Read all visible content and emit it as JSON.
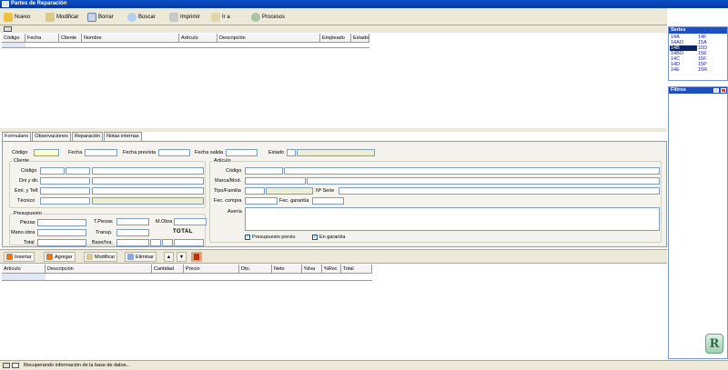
{
  "window": {
    "title": "Partes de Reparación"
  },
  "toolbar": {
    "nuevo": "Nuevo",
    "modificar": "Modificar",
    "borrar": "Borrar",
    "buscar": "Buscar",
    "imprimir": "Imprimir",
    "ira": "Ir a",
    "procesos": "Procesos"
  },
  "top_grid": {
    "columns": [
      "Código",
      "Fecha",
      "Cliente",
      "Nombre",
      "Artículo",
      "Descripción",
      "Empleado",
      "Estado"
    ]
  },
  "series_panel": {
    "title": "Series",
    "items": [
      "14A",
      "14F",
      "14AO",
      "15A",
      "14B",
      "15D",
      "14BO",
      "15E",
      "14C",
      "15F",
      "14D",
      "15P",
      "14E",
      "15R"
    ],
    "selected": "14B"
  },
  "filters_panel": {
    "title": "Filtros"
  },
  "tabs": [
    "Formulario",
    "Observaciones",
    "Reparación",
    "Notas internas"
  ],
  "form": {
    "codigo": "Código",
    "fecha": "Fecha",
    "fecha_prevista": "Fecha prevista",
    "fecha_salida": "Fecha salida",
    "estado": "Estado",
    "cliente_group": "Cliente",
    "cli_codigo": "Código",
    "cli_dni": "Dni y dir.",
    "cli_email": "Eml. y Telf.",
    "cli_tecnico": "Técnico",
    "articulo_group": "Artículo",
    "art_codigo": "Código",
    "art_marca": "Marca/Mod.",
    "art_tipo": "Tipo/Familia",
    "art_nserie": "Nº Serie",
    "art_fec_compra": "Fec. compra",
    "art_fec_garantia": "Fec. garantía",
    "art_averia": "Avería",
    "presupuesto_previo": "Presupuesto previo",
    "en_garantia": "En garantía",
    "presupuesto_group": "Presupuesto",
    "piezas": "Piezas",
    "mano_obra": "Mano obra",
    "total": "Total",
    "t_piezas": "T.Piezas",
    "m_obra": "M.Obra",
    "transp": "Transp.",
    "base_iva": "Base/Iva.",
    "total_big": "TOTAL"
  },
  "lines_toolbar": {
    "insertar": "Insertar",
    "agregar": "Agregar",
    "modificar": "Modificar",
    "eliminar": "Eliminar"
  },
  "lines_grid": {
    "columns": [
      "Artículo",
      "Descripción",
      "Cantidad",
      "Precio",
      "Dto.",
      "Neto",
      "%Iva",
      "%Rec",
      "Total"
    ]
  },
  "status": {
    "text": "Recuperando información de la base de datos..."
  },
  "logo": {
    "letter": "R"
  }
}
